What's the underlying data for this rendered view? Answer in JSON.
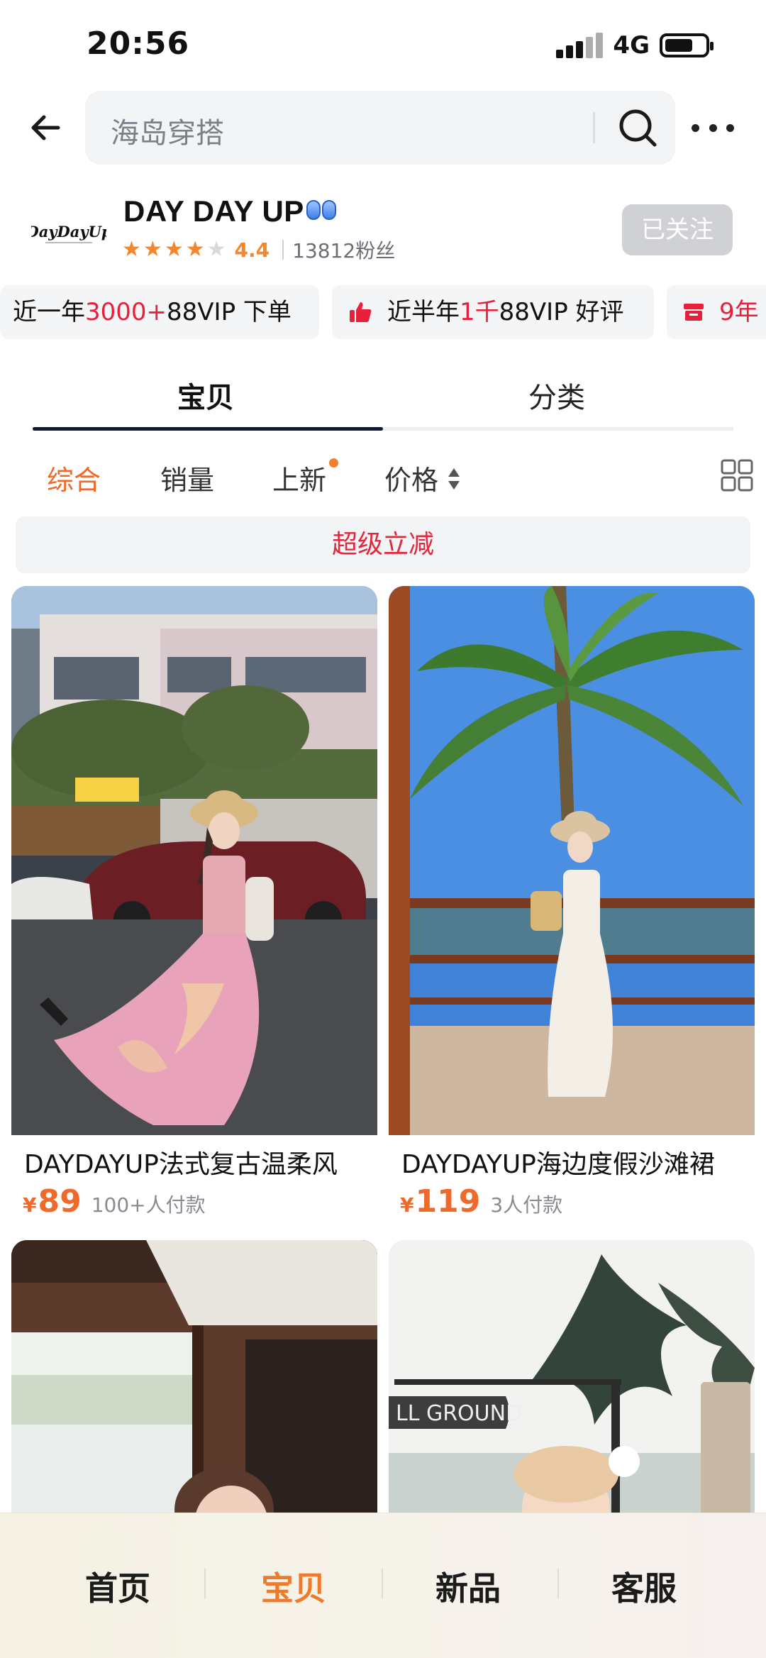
{
  "status_bar": {
    "time": "20:56",
    "network": "4G"
  },
  "search": {
    "placeholder": "海岛穿搭"
  },
  "shop": {
    "logo_text": "DayDayUp",
    "name": "DAY DAY UP",
    "rating": "4.4",
    "stars": 4,
    "fans": "13812粉丝",
    "follow_label": "已关注"
  },
  "chips": [
    {
      "prefix": "近一年",
      "highlight": "3000+",
      "suffix": "88VIP 下单"
    },
    {
      "prefix": "近半年",
      "highlight": "1千",
      "suffix": "88VIP 好评"
    },
    {
      "prefix": "",
      "highlight": "9年",
      "suffix": ""
    }
  ],
  "tabs": [
    {
      "label": "宝贝",
      "active": true
    },
    {
      "label": "分类",
      "active": false
    }
  ],
  "sort": [
    {
      "label": "综合",
      "active": true
    },
    {
      "label": "销量",
      "active": false
    },
    {
      "label": "上新",
      "active": false,
      "dot": true
    },
    {
      "label": "价格",
      "active": false
    }
  ],
  "promo": {
    "label": "超级立减"
  },
  "products": [
    {
      "title": "DAYDAYUP法式复古温柔风",
      "currency": "¥",
      "price": "89",
      "sold": "100+人付款"
    },
    {
      "title": "DAYDAYUP海边度假沙滩裙",
      "currency": "¥",
      "price": "119",
      "sold": "3人付款"
    },
    {
      "title": "",
      "currency": "",
      "price": "",
      "sold": ""
    },
    {
      "title": "",
      "currency": "",
      "price": "",
      "sold": "",
      "sign_text": "LL GROUND"
    }
  ],
  "bottom_nav": [
    {
      "label": "首页",
      "active": false
    },
    {
      "label": "宝贝",
      "active": true
    },
    {
      "label": "新品",
      "active": false
    },
    {
      "label": "客服",
      "active": false
    }
  ],
  "colors": {
    "accent": "#ef6a2a",
    "promo_red": "#e2273c",
    "star": "#f4872d"
  }
}
